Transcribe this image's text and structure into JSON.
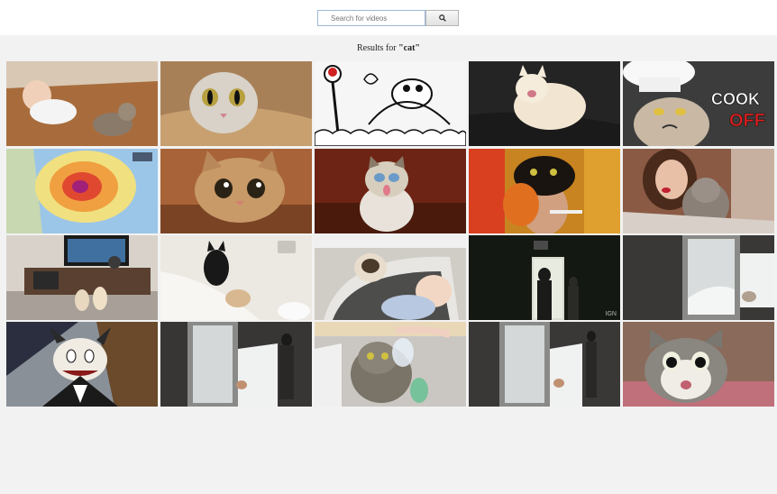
{
  "search": {
    "placeholder": "Search for videos",
    "button_icon": "search-icon"
  },
  "results": {
    "prefix": "Results for ",
    "query": "\"cat\""
  },
  "thumbnails": [
    {
      "name": "video-thumb-baby-kitten",
      "bg": "#b07848"
    },
    {
      "name": "video-thumb-cat-paper-bag",
      "bg": "#8a6a4a"
    },
    {
      "name": "video-thumb-simons-cat-cartoon",
      "bg": "#f4f4f4"
    },
    {
      "name": "video-thumb-white-cat-couch",
      "bg": "#2a2a2a"
    },
    {
      "name": "video-thumb-grumpy-cat-cook-off",
      "bg": "#3a3a3a",
      "overlay": "COOK OFF"
    },
    {
      "name": "video-thumb-weather-map",
      "bg": "#6fa8d8"
    },
    {
      "name": "video-thumb-tabby-cat-face",
      "bg": "#a0623a"
    },
    {
      "name": "video-thumb-grumpy-cat-red",
      "bg": "#7a2a18"
    },
    {
      "name": "video-thumb-cat-on-head",
      "bg": "#c08020"
    },
    {
      "name": "video-thumb-woman-with-cat",
      "bg": "#7a4a38"
    },
    {
      "name": "video-thumb-dogs-living-room",
      "bg": "#c9c2b8"
    },
    {
      "name": "video-thumb-cats-bathroom",
      "bg": "#e6e2dc"
    },
    {
      "name": "video-thumb-cat-baby-bouncer",
      "bg": "#d8d6d2"
    },
    {
      "name": "video-thumb-dark-hallway",
      "bg": "#161a14",
      "watermark": "IGN"
    },
    {
      "name": "video-thumb-cat-door-snow",
      "bg": "#3e3c3a"
    },
    {
      "name": "video-thumb-cartoon-cat-tux",
      "bg": "#2a2e3e"
    },
    {
      "name": "video-thumb-woman-door-snow",
      "bg": "#3a3836"
    },
    {
      "name": "video-thumb-cat-water-bottle",
      "bg": "#c8c4c0"
    },
    {
      "name": "video-thumb-door-snow-person",
      "bg": "#3e3c3a"
    },
    {
      "name": "video-thumb-surprised-cat",
      "bg": "#9a7a6a"
    }
  ]
}
